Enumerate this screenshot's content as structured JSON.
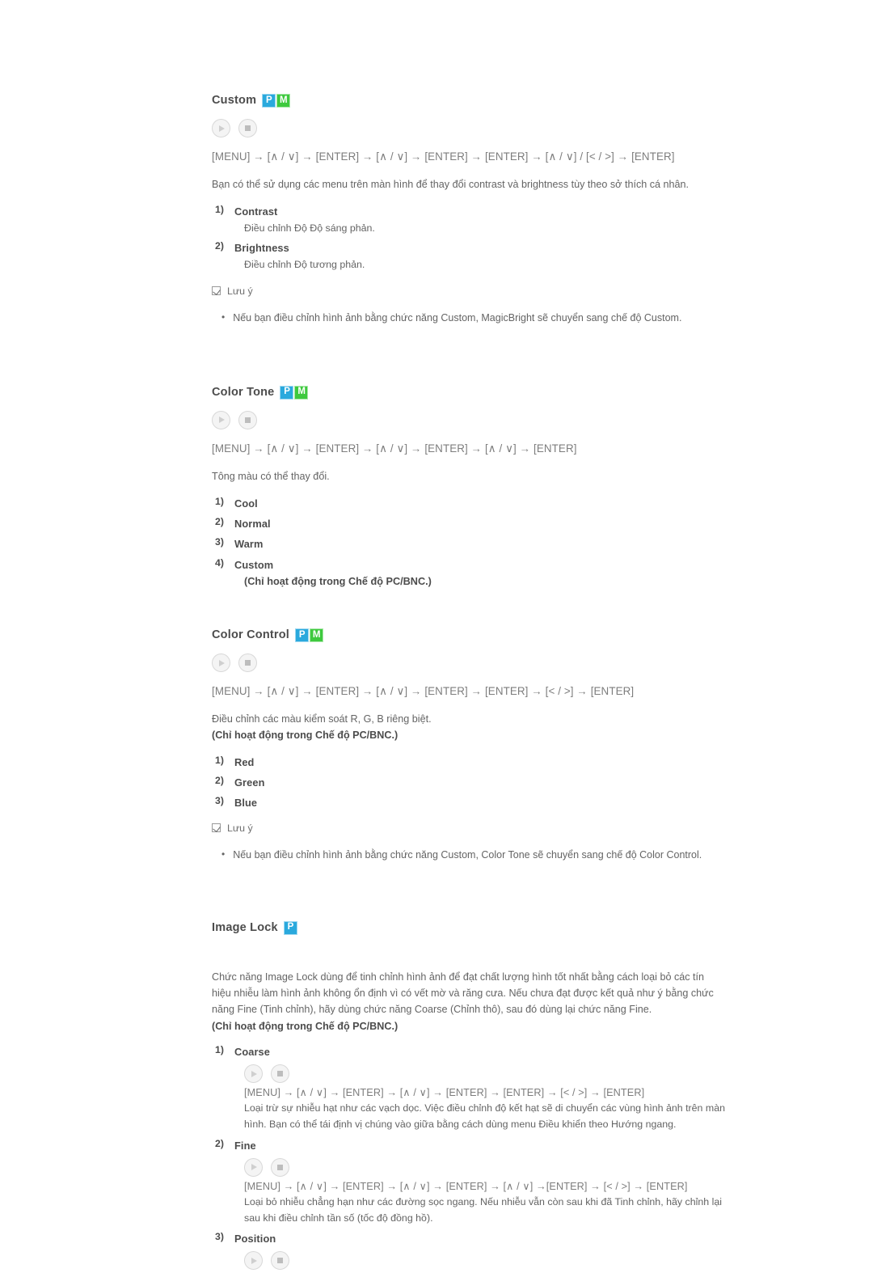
{
  "badges": {
    "p": "P",
    "m": "M"
  },
  "icons": {
    "play": "play-icon",
    "stop": "stop-icon",
    "note": "note-check-icon"
  },
  "sections": [
    {
      "title": "Custom",
      "badges": [
        "P",
        "M"
      ],
      "nav": "[MENU] → [∧ / ∨] → [ENTER] → [∧ / ∨] → [ENTER] → [ENTER] → [∧ / ∨] / [< / >] → [ENTER]",
      "intro": "Bạn có thể sử dụng các menu trên màn hình để thay đổi contrast và brightness tùy theo sở thích cá nhân.",
      "items": [
        {
          "num": "1)",
          "title": "Contrast",
          "desc": "Điều chỉnh Độ Độ sáng phản."
        },
        {
          "num": "2)",
          "title": "Brightness",
          "desc": "Điều chỉnh Độ tương phản."
        }
      ],
      "note": {
        "label": "Lưu ý",
        "bullets": [
          "Nếu bạn điều chỉnh hình ảnh bằng chức năng Custom, MagicBright sẽ chuyển sang chế độ Custom."
        ]
      }
    },
    {
      "title": "Color Tone",
      "badges": [
        "P",
        "M"
      ],
      "nav": "[MENU] → [∧ / ∨] → [ENTER] → [∧ / ∨] → [ENTER] → [∧ / ∨] → [ENTER]",
      "intro": "Tông màu có thể thay đổi.",
      "items": [
        {
          "num": "1)",
          "title": "Cool"
        },
        {
          "num": "2)",
          "title": "Normal"
        },
        {
          "num": "3)",
          "title": "Warm"
        },
        {
          "num": "4)",
          "title": "Custom",
          "note": "(Chỉ hoạt động trong Chế độ PC/BNC.)"
        }
      ]
    },
    {
      "title": "Color Control",
      "badges": [
        "P",
        "M"
      ],
      "nav": "[MENU] → [∧ / ∨] → [ENTER] → [∧ / ∨] → [ENTER] → [ENTER] → [< / >] → [ENTER]",
      "intro": "Điều chỉnh các màu kiểm soát R, G, B riêng biệt.",
      "intro_bold": "(Chỉ hoạt động trong Chế độ PC/BNC.)",
      "items": [
        {
          "num": "1)",
          "title": "Red"
        },
        {
          "num": "2)",
          "title": "Green"
        },
        {
          "num": "3)",
          "title": "Blue"
        }
      ],
      "note": {
        "label": "Lưu ý",
        "bullets": [
          "Nếu bạn điều chỉnh hình ảnh bằng chức năng Custom, Color Tone sẽ chuyển sang chế độ Color Control."
        ]
      }
    },
    {
      "title": "Image Lock",
      "badges": [
        "P"
      ],
      "body": "Chức năng Image Lock dùng để tinh chỉnh hình ảnh để đạt chất lượng hình tốt nhất bằng cách loại bỏ các tín hiệu nhiễu làm hình ảnh không ổn định vì có vết mờ và răng cưa. Nếu chưa đạt được kết quả như ý bằng chức năng Fine (Tinh chỉnh), hãy dùng chức năng Coarse (Chỉnh thô), sau đó dùng lại chức năng Fine.",
      "body_bold": "(Chỉ hoạt động trong Chế độ PC/BNC.)",
      "subitems": [
        {
          "num": "1)",
          "title": "Coarse",
          "nav": "[MENU] → [∧ / ∨] → [ENTER] → [∧ / ∨] → [ENTER] → [ENTER] → [< / >] → [ENTER]",
          "desc": "Loại trừ sự nhiễu hạt như các vạch dọc. Việc điều chỉnh độ kết hạt sẽ di chuyển các vùng hình ảnh trên màn hình. Bạn có thể tái định vị chúng vào giữa bằng cách dùng menu Điều khiển theo Hướng ngang."
        },
        {
          "num": "2)",
          "title": "Fine",
          "nav": "[MENU] → [∧ / ∨] → [ENTER] → [∧ / ∨] → [ENTER] → [∧ / ∨] →[ENTER] → [< / >] → [ENTER]",
          "desc": "Loại bỏ nhiễu chẳng hạn như các đường sọc ngang. Nếu nhiễu vẫn còn sau khi đã Tinh chỉnh, hãy chỉnh lại sau khi điều chỉnh tần số (tốc độ đồng hồ)."
        },
        {
          "num": "3)",
          "title": "Position"
        }
      ]
    }
  ]
}
